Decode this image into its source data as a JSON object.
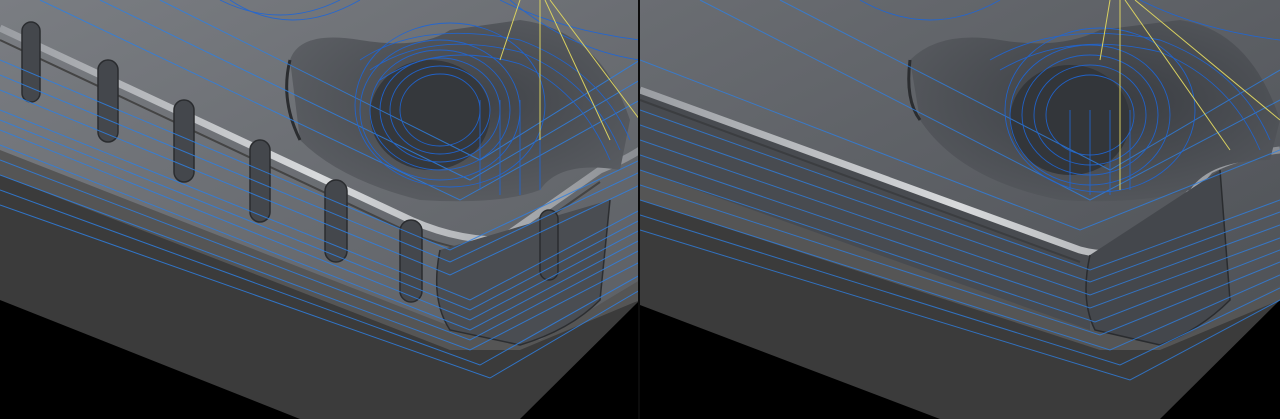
{
  "scene": {
    "background_color": "#000000",
    "stock_side_color": "#3c3c3c",
    "stock_top_color": "#585858",
    "part_color": "#6a6d72",
    "toolpath_color": "#2f7fe0",
    "toolpath_dense_color": "#1f66d6",
    "link_move_color": "#d8d060"
  },
  "panels": [
    {
      "view": "left",
      "features": [
        "slot-pockets",
        "rim",
        "corner-fillet",
        "toolpaths"
      ],
      "slot_count": 7
    },
    {
      "view": "right",
      "features": [
        "rim",
        "corner-fillet",
        "toolpaths"
      ],
      "slot_count": 0
    }
  ]
}
